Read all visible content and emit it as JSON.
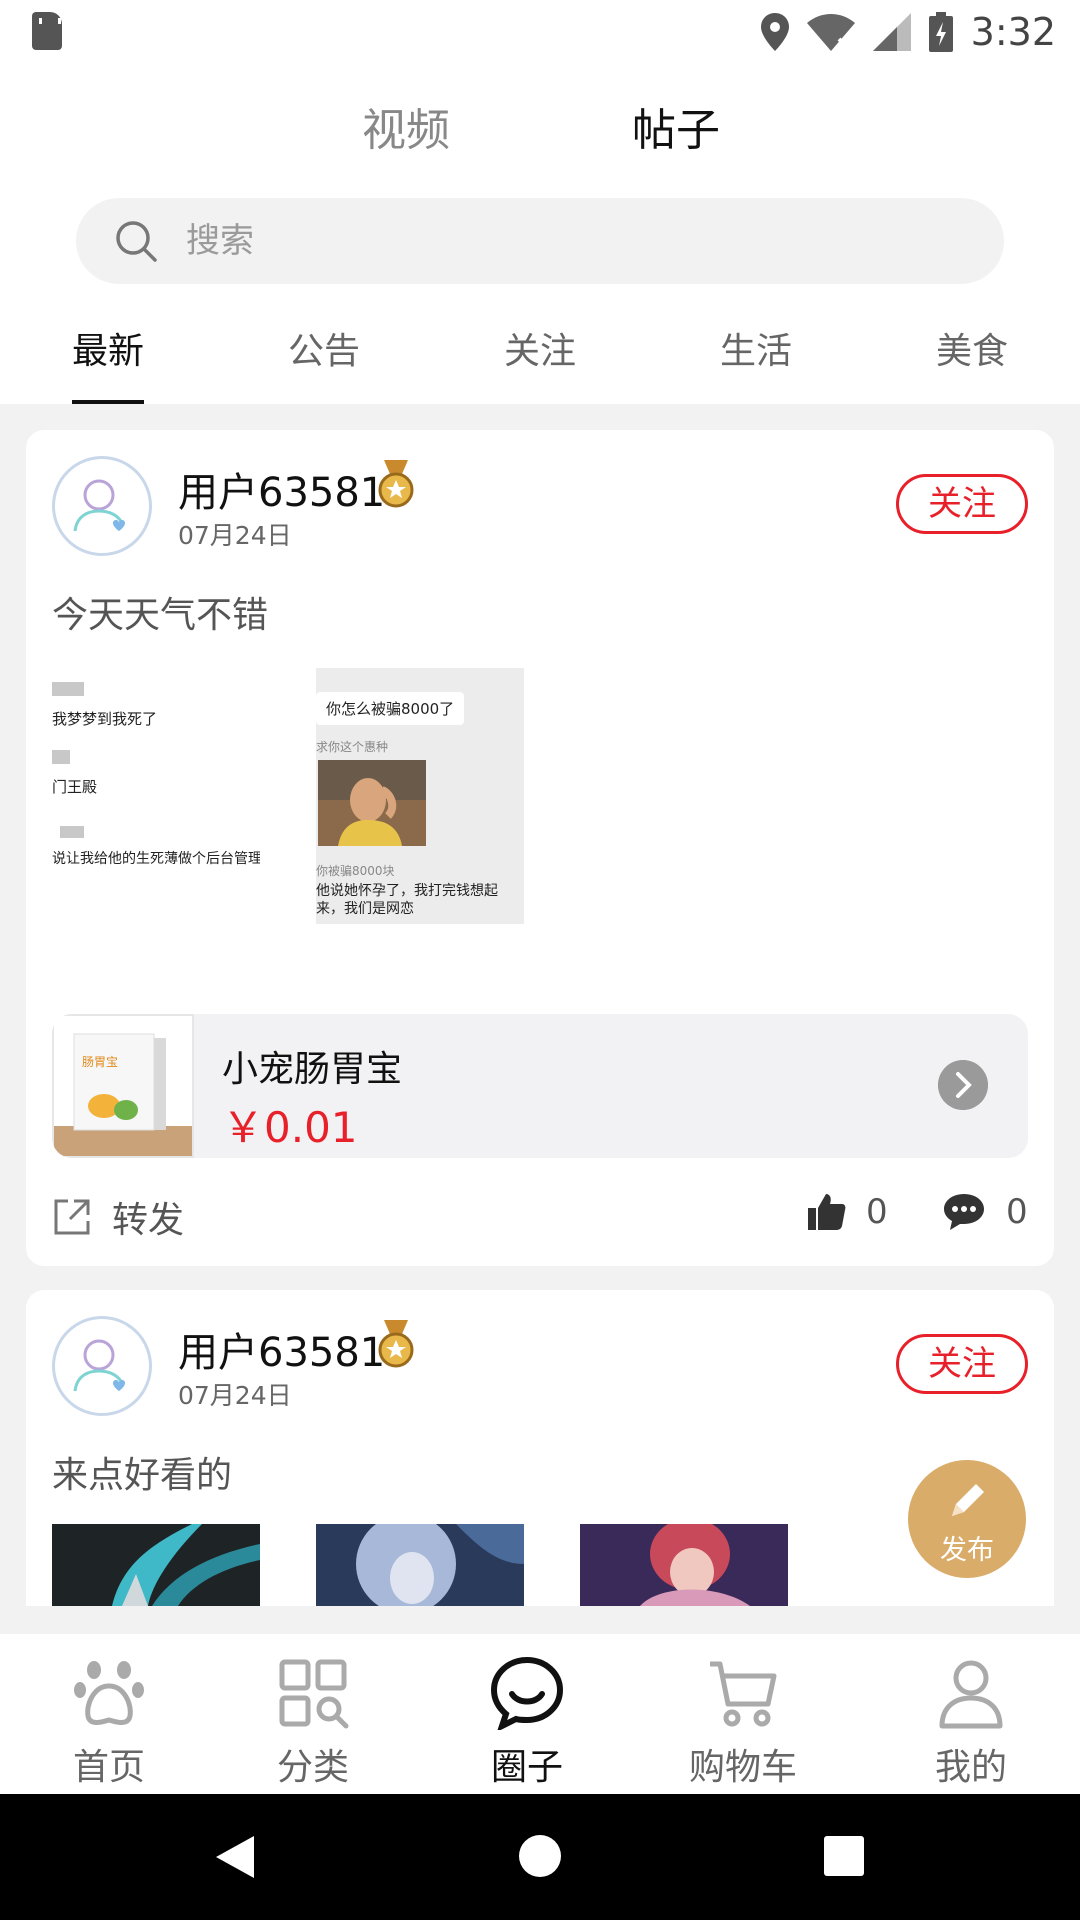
{
  "status_bar": {
    "time": "3:32"
  },
  "header": {
    "top_tabs": [
      {
        "label": "视频"
      },
      {
        "label": "帖子"
      }
    ],
    "search": {
      "placeholder": "搜索"
    },
    "category_tabs": [
      {
        "label": "最新"
      },
      {
        "label": "公告"
      },
      {
        "label": "关注"
      },
      {
        "label": "生活"
      },
      {
        "label": "美食"
      }
    ]
  },
  "posts": [
    {
      "username": "用户63581",
      "date": "07月24日",
      "follow_label": "关注",
      "text": "今天天气不错",
      "image1_texts": [
        "我梦梦到我死了",
        "门王殿",
        "说让我给他的生死薄做个后台管理"
      ],
      "image2_texts": [
        "你怎么被骗8000了",
        "求你这个惠种",
        "你被骗8000块",
        "他说她怀孕了，我打完钱想起来，我们是网恋"
      ],
      "product": {
        "name": "小宠肠胃宝",
        "price": "￥0.01",
        "box_text": "肠胃宝"
      },
      "share_label": "转发",
      "likes": "0",
      "comments": "0"
    },
    {
      "username": "用户63581",
      "date": "07月24日",
      "follow_label": "关注",
      "text": "来点好看的"
    }
  ],
  "publish_label": "发布",
  "bottom_nav": [
    {
      "label": "首页",
      "icon": "paw-icon"
    },
    {
      "label": "分类",
      "icon": "category-icon"
    },
    {
      "label": "圈子",
      "icon": "circle-chat-icon"
    },
    {
      "label": "购物车",
      "icon": "cart-icon"
    },
    {
      "label": "我的",
      "icon": "user-icon"
    }
  ],
  "colors": {
    "accent_red": "#e8202a",
    "publish_gold": "#d9ac6a"
  }
}
